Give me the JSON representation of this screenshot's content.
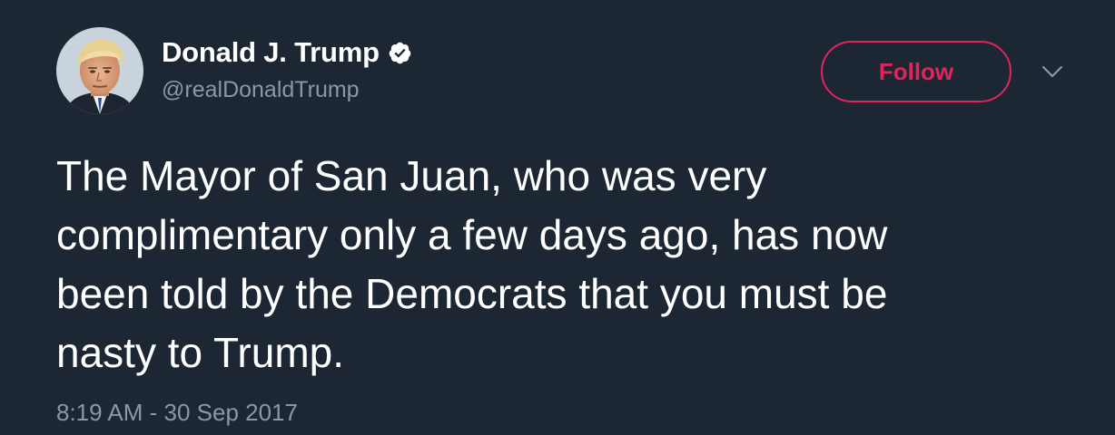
{
  "tweet": {
    "author": {
      "display_name": "Donald J. Trump",
      "handle": "@realDonaldTrump",
      "verified": true
    },
    "follow_label": "Follow",
    "text": "The Mayor of San Juan, who was very\ncomplimentary only a few days ago, has now\nbeen told by the Democrats that you must be\nnasty to Trump.",
    "timestamp": "8:19 AM - 30 Sep 2017"
  },
  "icons": {
    "verified": "verified-badge-icon",
    "menu": "chevron-down-icon",
    "avatar": "profile-photo"
  },
  "colors": {
    "background": "#1c2733",
    "text_primary": "#ffffff",
    "text_secondary": "#8899a6",
    "follow_accent": "#e0245e"
  }
}
